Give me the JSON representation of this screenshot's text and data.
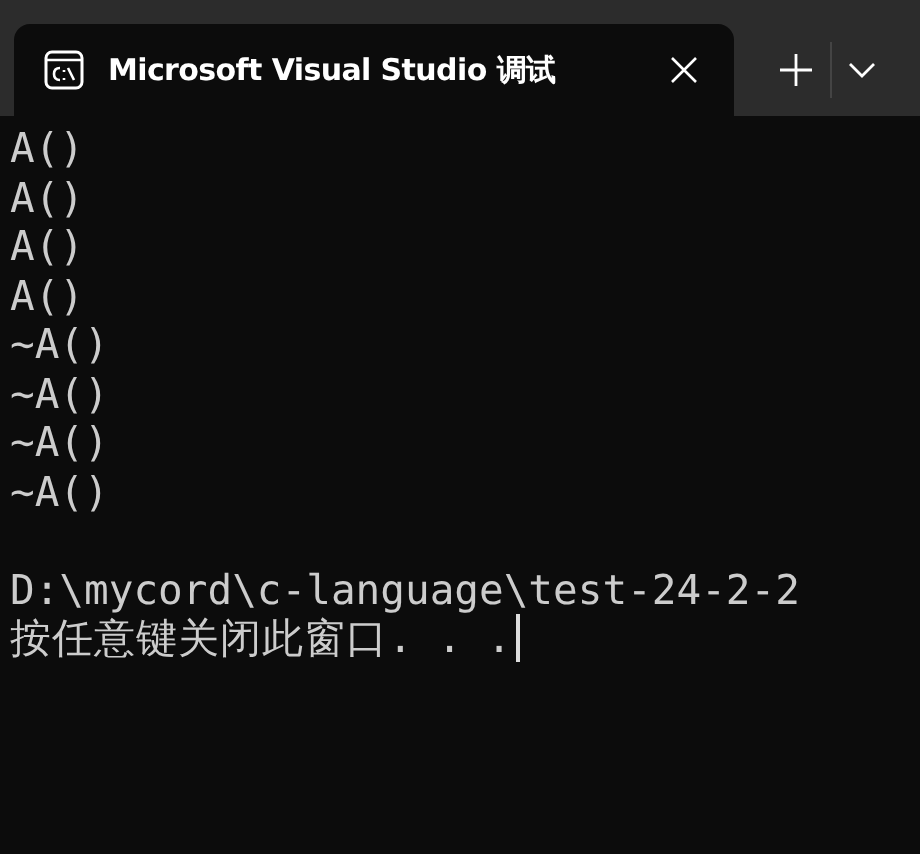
{
  "tabs": [
    {
      "title": "Microsoft Visual Studio 调试",
      "selected": true
    }
  ],
  "terminal": {
    "lines": [
      {
        "kind": "text",
        "text": "A()"
      },
      {
        "kind": "text",
        "text": "A()"
      },
      {
        "kind": "text",
        "text": "A()"
      },
      {
        "kind": "text",
        "text": "A()"
      },
      {
        "kind": "text",
        "text": "~A()"
      },
      {
        "kind": "text",
        "text": "~A()"
      },
      {
        "kind": "text",
        "text": "~A()"
      },
      {
        "kind": "text",
        "text": "~A()"
      },
      {
        "kind": "blank"
      },
      {
        "kind": "text",
        "text": "D:\\mycord\\c-language\\test-24-2-2"
      },
      {
        "kind": "text",
        "text": "按任意键关闭此窗口. . ."
      }
    ],
    "cursor": true
  }
}
